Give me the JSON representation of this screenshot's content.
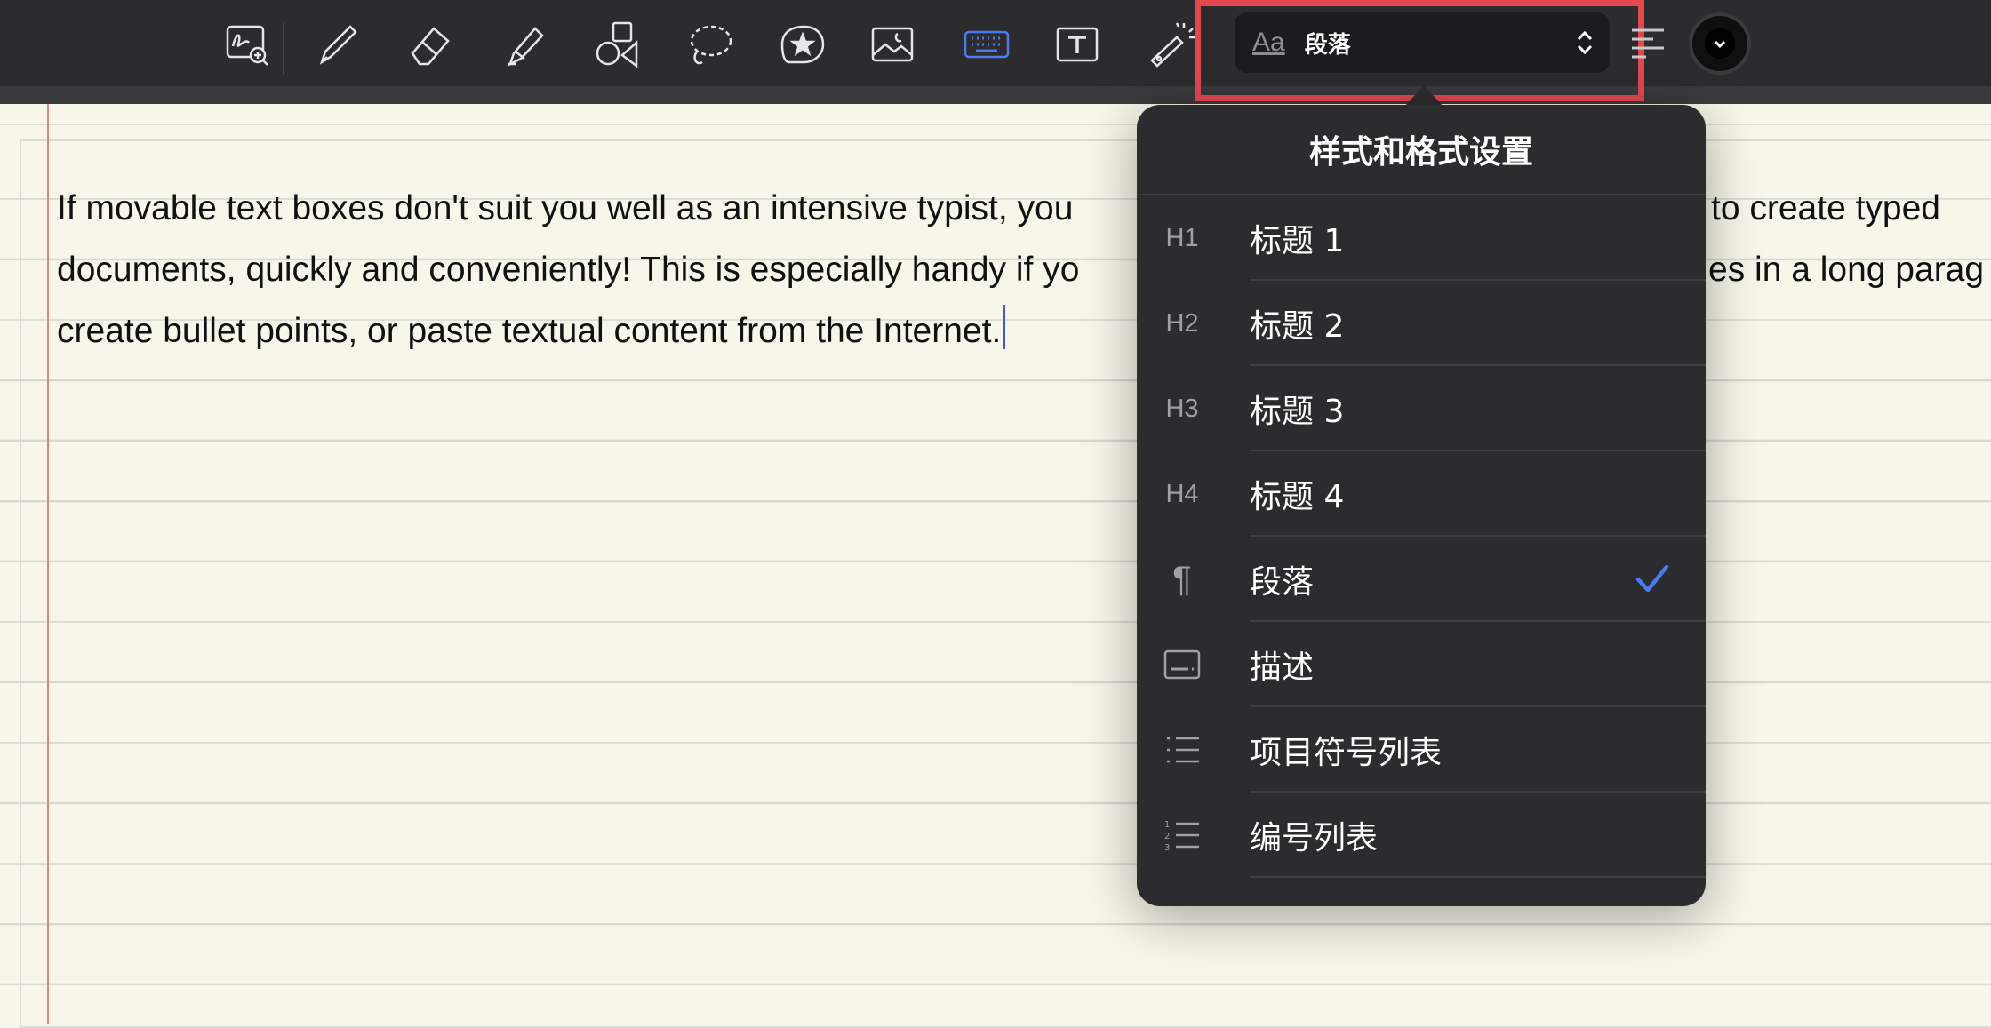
{
  "toolbar": {
    "tools": [
      {
        "name": "zoom-writing-icon"
      },
      {
        "name": "pen-icon"
      },
      {
        "name": "eraser-icon"
      },
      {
        "name": "highlighter-icon"
      },
      {
        "name": "shapes-icon"
      },
      {
        "name": "lasso-icon"
      },
      {
        "name": "sticker-icon"
      },
      {
        "name": "image-icon"
      },
      {
        "name": "keyboard-icon",
        "active": true
      },
      {
        "name": "text-box-icon"
      },
      {
        "name": "laser-pointer-icon"
      }
    ],
    "style_aa": "Aa",
    "style_value": "段落",
    "accent_color": "#4a7cf0",
    "highlight_color": "#e5474f"
  },
  "document": {
    "lines": [
      "If movable text boxes don't suit you well as an intensive typist, you",
      "documents, quickly and conveniently! This is especially handy if yo",
      "create bullet points, or paste textual content from the Internet."
    ],
    "right_fragments": [
      "to create typed",
      "es in a long parag"
    ]
  },
  "popover": {
    "title": "样式和格式设置",
    "items": [
      {
        "icon": "H1",
        "label": "标题 1",
        "selected": false
      },
      {
        "icon": "H2",
        "label": "标题 2",
        "selected": false
      },
      {
        "icon": "H3",
        "label": "标题 3",
        "selected": false
      },
      {
        "icon": "H4",
        "label": "标题 4",
        "selected": false
      },
      {
        "icon": "¶",
        "label": "段落",
        "selected": true
      },
      {
        "icon": "caption-icon",
        "label": "描述",
        "selected": false
      },
      {
        "icon": "bullet-list-icon",
        "label": "项目符号列表",
        "selected": false
      },
      {
        "icon": "numbered-list-icon",
        "label": "编号列表",
        "selected": false
      }
    ]
  }
}
